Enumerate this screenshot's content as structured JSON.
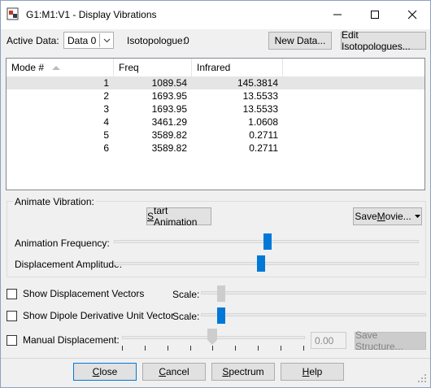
{
  "window": {
    "title": "G1:M1:V1 - Display Vibrations",
    "minimize": "—",
    "maximize": "☐",
    "close": "✕"
  },
  "toolbar": {
    "active_data_label": "Active Data:",
    "active_data_value": "Data 0",
    "isotopologue_label": "Isotopologue:",
    "isotopologue_value": "0",
    "new_data_label": "New Data...",
    "edit_isotopologues_label": "Edit Isotopologues..."
  },
  "table": {
    "columns": [
      "Mode #",
      "Freq",
      "Infrared"
    ],
    "rows": [
      {
        "mode": "1",
        "freq": "1089.54",
        "ir": "145.3814"
      },
      {
        "mode": "2",
        "freq": "1693.95",
        "ir": "13.5533"
      },
      {
        "mode": "3",
        "freq": "1693.95",
        "ir": "13.5533"
      },
      {
        "mode": "4",
        "freq": "3461.29",
        "ir": "1.0608"
      },
      {
        "mode": "5",
        "freq": "3589.82",
        "ir": "0.2711"
      },
      {
        "mode": "6",
        "freq": "3589.82",
        "ir": "0.2711"
      }
    ]
  },
  "animate": {
    "group_label": "Animate Vibration:",
    "start_first": "S",
    "start_rest": "tart Animation",
    "save_movie_a": "Save ",
    "save_movie_u": "M",
    "save_movie_b": "ovie...",
    "frequency_label": "Animation Frequency:",
    "frequency_level": 0.49,
    "amplitude_label": "Displacement Amplitude:",
    "amplitude_level": 0.47
  },
  "options": {
    "displacement_vectors_label": "Show Displacement Vectors",
    "dipole_label": "Show Dipole Derivative Unit Vector",
    "scale_label": "Scale:",
    "manual_label": "Manual Displacement:",
    "manual_value": "0.00",
    "save_structure_label": "Save Structure..."
  },
  "footer": {
    "close_u": "C",
    "close_rest": "lose",
    "cancel_a": "",
    "cancel_u": "C",
    "cancel_rest": "ancel",
    "spectrum_a": "",
    "spectrum_u": "S",
    "spectrum_rest": "pectrum",
    "help_u": "H",
    "help_rest": "elp"
  },
  "colors": {
    "accent": "#0078d7",
    "selected_row": "#e5e5e5"
  }
}
